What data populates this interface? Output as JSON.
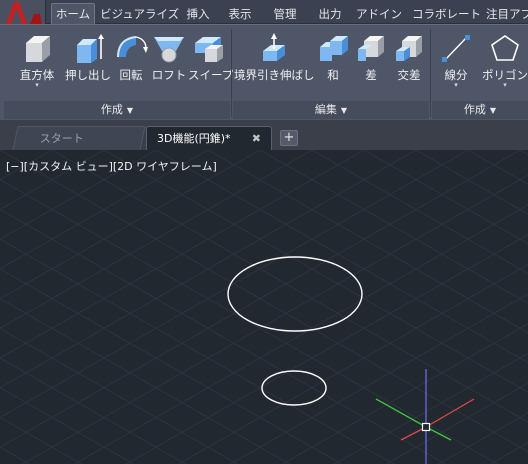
{
  "menubar": {
    "tabs": [
      "ホーム",
      "ビジュアライズ",
      "挿入",
      "表示",
      "管理",
      "出力",
      "アドイン",
      "コラボレート",
      "注目アプ"
    ],
    "active_index": 0
  },
  "ribbon": {
    "tools": [
      {
        "label": "直方体",
        "icon": "box-icon",
        "dropdown": "▾"
      },
      {
        "label": "押し出し",
        "icon": "extrude-icon",
        "dropdown": ""
      },
      {
        "label": "回転",
        "icon": "revolve-icon",
        "dropdown": ""
      },
      {
        "label": "ロフト",
        "icon": "loft-icon",
        "dropdown": ""
      },
      {
        "label": "スイープ",
        "icon": "sweep-icon",
        "dropdown": ""
      },
      {
        "label": "境界引き伸ばし",
        "icon": "presspull-icon",
        "dropdown": ""
      },
      {
        "label": "和",
        "icon": "union-icon",
        "dropdown": ""
      },
      {
        "label": "差",
        "icon": "subtract-icon",
        "dropdown": ""
      },
      {
        "label": "交差",
        "icon": "intersect-icon",
        "dropdown": ""
      },
      {
        "label": "線分",
        "icon": "line-icon",
        "dropdown": "▾"
      },
      {
        "label": "ポリゴン",
        "icon": "polygon-icon",
        "dropdown": "▾"
      }
    ],
    "panels": [
      {
        "label": "作成",
        "arrow": "▼"
      },
      {
        "label": "編集",
        "arrow": "▼"
      },
      {
        "label": "作成",
        "arrow": "▼"
      }
    ]
  },
  "file_tabs": {
    "start_label": "スタート",
    "document_label": "3D機能(円錐)*",
    "close_glyph": "✖",
    "new_tab_glyph": "+"
  },
  "viewport": {
    "label": "[−][カスタム ビュー][2D ワイヤフレーム]",
    "background": "#212830",
    "grid_color": "#2c3440",
    "axis_colors": {
      "x": "#e04848",
      "y": "#3cc83c",
      "z": "#6a6ae8"
    }
  },
  "colors": {
    "menubar": "#3b4150",
    "ribbon": "#4e5668",
    "panel_footer": "#454c5b",
    "logo_red": "#c81e1e"
  }
}
